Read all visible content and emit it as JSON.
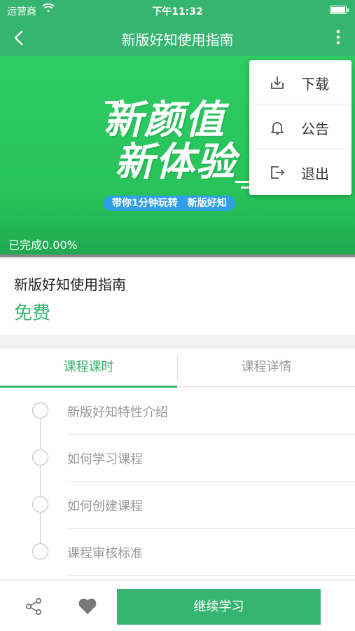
{
  "status_bar": {
    "carrier": "运营商",
    "time": "下午11:32"
  },
  "nav": {
    "title": "新版好知使用指南"
  },
  "banner": {
    "slogan_line1": "新颜值",
    "slogan_line2": "新体验",
    "tag": "带你1分钟玩转　新版好知",
    "progress": "已完成0.00%"
  },
  "menu": {
    "items": [
      {
        "label": "下载",
        "icon": "download-icon"
      },
      {
        "label": "公告",
        "icon": "bell-icon"
      },
      {
        "label": "退出",
        "icon": "logout-icon"
      }
    ]
  },
  "course": {
    "name": "新版好知使用指南",
    "price": "免费"
  },
  "tabs": [
    {
      "label": "课程课时",
      "active": true
    },
    {
      "label": "课程详情",
      "active": false
    }
  ],
  "lessons": [
    {
      "title": "新版好知特性介绍"
    },
    {
      "title": "如何学习课程"
    },
    {
      "title": "如何创建课程"
    },
    {
      "title": "课程审核标准"
    }
  ],
  "bottom_bar": {
    "cta_label": "继续学习"
  },
  "colors": {
    "accent": "#35b56f",
    "banner_green": "#2fcc63",
    "tag_blue": "#2f9fe8"
  }
}
